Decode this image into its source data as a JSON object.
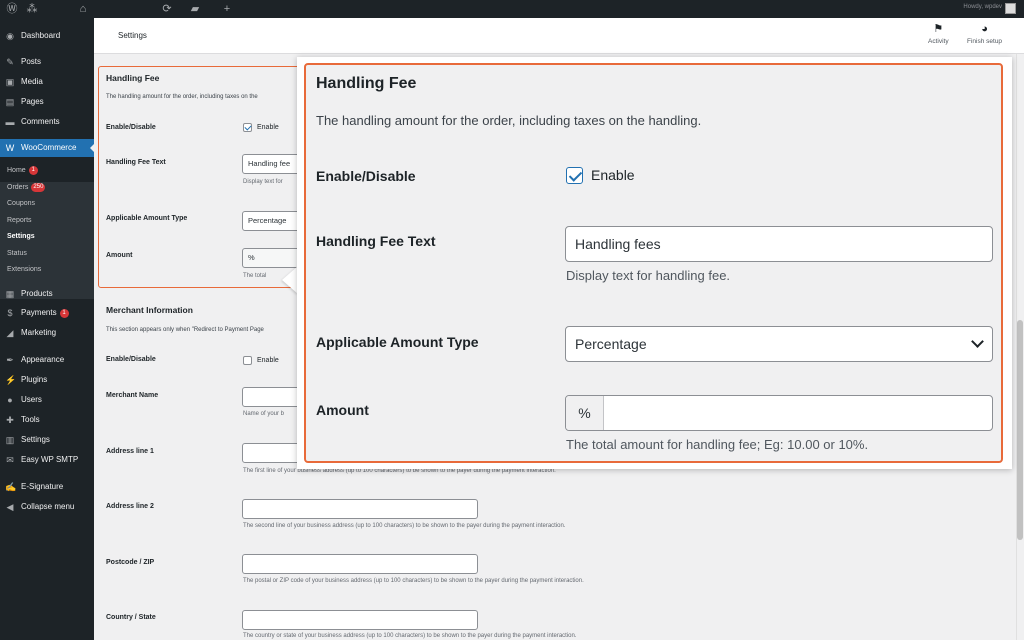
{
  "adminbar": {
    "icons": [
      "wordpress-logo-icon",
      "my-sites-icon",
      "home-icon",
      "updates-icon",
      "comments-icon",
      "new-icon"
    ],
    "howdy": "Howdy, wpdev"
  },
  "sidebar": {
    "items": [
      {
        "label": "Dashboard",
        "icon": "dashboard-icon",
        "glyph": "◉"
      },
      {
        "label": "Posts",
        "icon": "pin-icon",
        "glyph": "✎"
      },
      {
        "label": "Media",
        "icon": "media-icon",
        "glyph": "▣"
      },
      {
        "label": "Pages",
        "icon": "pages-icon",
        "glyph": "▤"
      },
      {
        "label": "Comments",
        "icon": "comments-icon",
        "glyph": "▬"
      },
      {
        "label": "WooCommerce",
        "icon": "woocommerce-icon",
        "glyph": "W"
      },
      {
        "label": "Products",
        "icon": "products-icon",
        "glyph": "▦"
      },
      {
        "label": "Payments",
        "icon": "payments-icon",
        "glyph": "$",
        "badge": "1"
      },
      {
        "label": "Marketing",
        "icon": "marketing-icon",
        "glyph": "◢"
      },
      {
        "label": "Appearance",
        "icon": "appearance-icon",
        "glyph": "✒"
      },
      {
        "label": "Plugins",
        "icon": "plugins-icon",
        "glyph": "⚡"
      },
      {
        "label": "Users",
        "icon": "users-icon",
        "glyph": "●"
      },
      {
        "label": "Tools",
        "icon": "tools-icon",
        "glyph": "✚"
      },
      {
        "label": "Settings",
        "icon": "settings-icon",
        "glyph": "▥"
      },
      {
        "label": "Easy WP SMTP",
        "icon": "smtp-icon",
        "glyph": "✉"
      },
      {
        "label": "E-Signature",
        "icon": "signature-icon",
        "glyph": "✍"
      },
      {
        "label": "Collapse menu",
        "icon": "collapse-icon",
        "glyph": "◀"
      }
    ],
    "submenu": [
      {
        "label": "Home",
        "badge": "1"
      },
      {
        "label": "Orders",
        "badge": "250"
      },
      {
        "label": "Coupons"
      },
      {
        "label": "Reports"
      },
      {
        "label": "Settings"
      },
      {
        "label": "Status"
      },
      {
        "label": "Extensions"
      }
    ]
  },
  "header": {
    "title": "Settings",
    "activity": "Activity",
    "finish_setup": "Finish setup"
  },
  "form": {
    "handling": {
      "title": "Handling Fee",
      "desc": "The handling amount for the order, including taxes on the",
      "enable_label": "Enable/Disable",
      "enable_text": "Enable",
      "fee_text_label": "Handling Fee Text",
      "fee_text_value": "Handling fee",
      "fee_text_hint": "Display text for",
      "amount_type_label": "Applicable Amount Type",
      "amount_type_value": "Percentage",
      "amount_label": "Amount",
      "amount_prefix": "%",
      "amount_hint": "The total"
    },
    "merchant": {
      "title": "Merchant Information",
      "desc": "This section appears only when \"Redirect to Payment Page",
      "enable_label": "Enable/Disable",
      "enable_text": "Enable",
      "name_label": "Merchant Name",
      "name_hint": "Name of your b",
      "addr1_label": "Address line 1",
      "addr1_hint": "The first line of your business address (up to 100 characters) to be shown to the payer during the payment interaction.",
      "addr2_label": "Address line 2",
      "addr2_hint": "The second line of your business address (up to 100 characters) to be shown to the payer during the payment interaction.",
      "zip_label": "Postcode / ZIP",
      "zip_hint": "The postal or ZIP code of your business address (up to 100 characters) to be shown to the payer during the payment interaction.",
      "country_label": "Country / State",
      "country_hint": "The country or state of your business address (up to 100 characters) to be shown to the payer during the payment interaction."
    }
  },
  "zoom": {
    "title": "Handling Fee",
    "desc": "The handling amount for the order, including taxes on the handling.",
    "enable_label": "Enable/Disable",
    "enable_text": "Enable",
    "fee_text_label": "Handling Fee Text",
    "fee_text_value": "Handling fees",
    "fee_text_hint": "Display text for handling fee.",
    "amount_type_label": "Applicable Amount Type",
    "amount_type_value": "Percentage",
    "amount_label": "Amount",
    "amount_prefix": "%",
    "amount_value": "",
    "amount_hint": "The total amount for handling fee; Eg: 10.00 or 10%."
  },
  "colors": {
    "highlight": "#e86a3a",
    "wp_blue": "#2271b1",
    "sidebar": "#1d2327"
  }
}
